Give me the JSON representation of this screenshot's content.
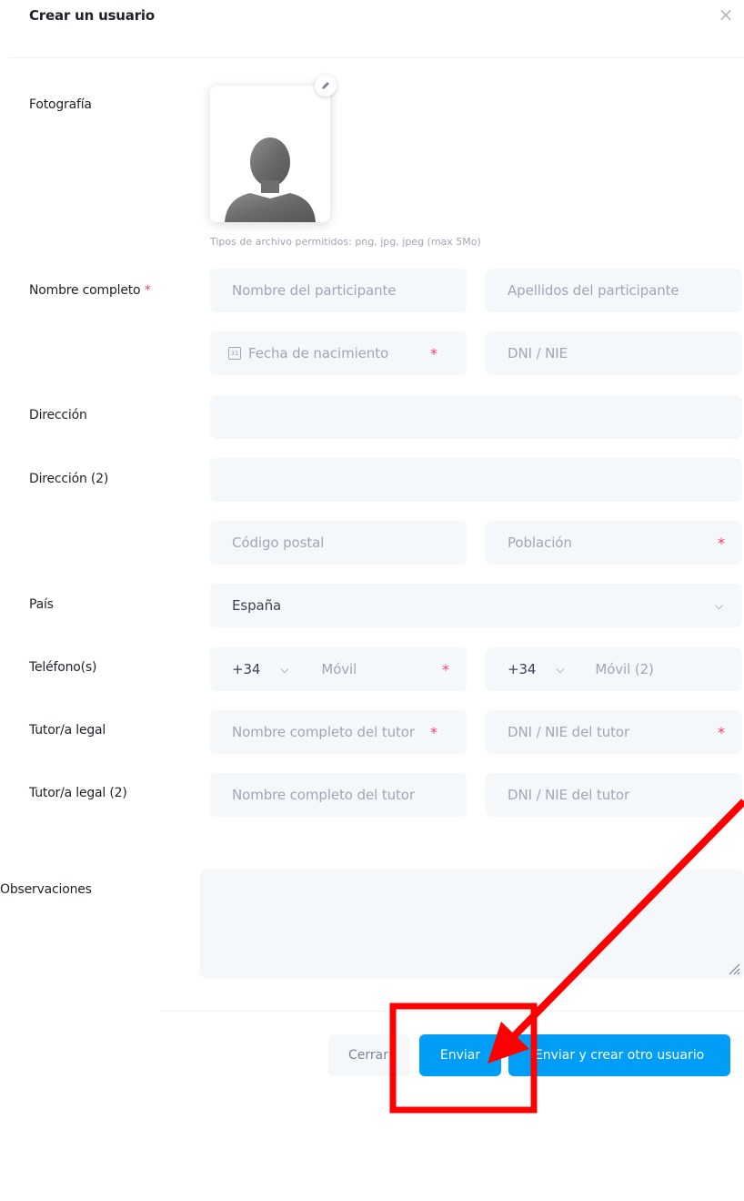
{
  "modal": {
    "title": "Crear un usuario",
    "close_icon": "close-icon"
  },
  "photo": {
    "label": "Fotografía",
    "hint": "Tipos de archivo permitidos: png, jpg, jpeg (max 5Mo)",
    "edit_icon": "pencil-icon"
  },
  "fields": {
    "full_name_label": "Nombre completo",
    "required_mark": "*",
    "first_name_placeholder": "Nombre del participante",
    "last_name_placeholder": "Apellidos del participante",
    "birthdate_placeholder": "Fecha de nacimiento",
    "dni_placeholder": "DNI / NIE",
    "address_label": "Dirección",
    "address2_label": "Dirección (2)",
    "postal_code_placeholder": "Código postal",
    "city_placeholder": "Población",
    "country_label": "País",
    "country_value": "España",
    "phones_label": "Teléfono(s)",
    "phone_code_1": "+34",
    "mobile_placeholder": "Móvil",
    "phone_code_2": "+34",
    "mobile2_placeholder": "Móvil (2)",
    "tutor_label": "Tutor/a legal",
    "tutor_name_placeholder": "Nombre completo del tutor",
    "tutor_dni_placeholder": "DNI / NIE del tutor",
    "tutor2_label": "Tutor/a legal (2)",
    "tutor2_name_placeholder": "Nombre completo del tutor",
    "tutor2_dni_placeholder": "DNI / NIE del tutor",
    "notes_label": "Observaciones"
  },
  "footer": {
    "close_label": "Cerrar",
    "submit_label": "Enviar",
    "submit_new_label": "Enviar y crear otro usuario"
  },
  "annotation": {
    "color": "#ff0000"
  }
}
